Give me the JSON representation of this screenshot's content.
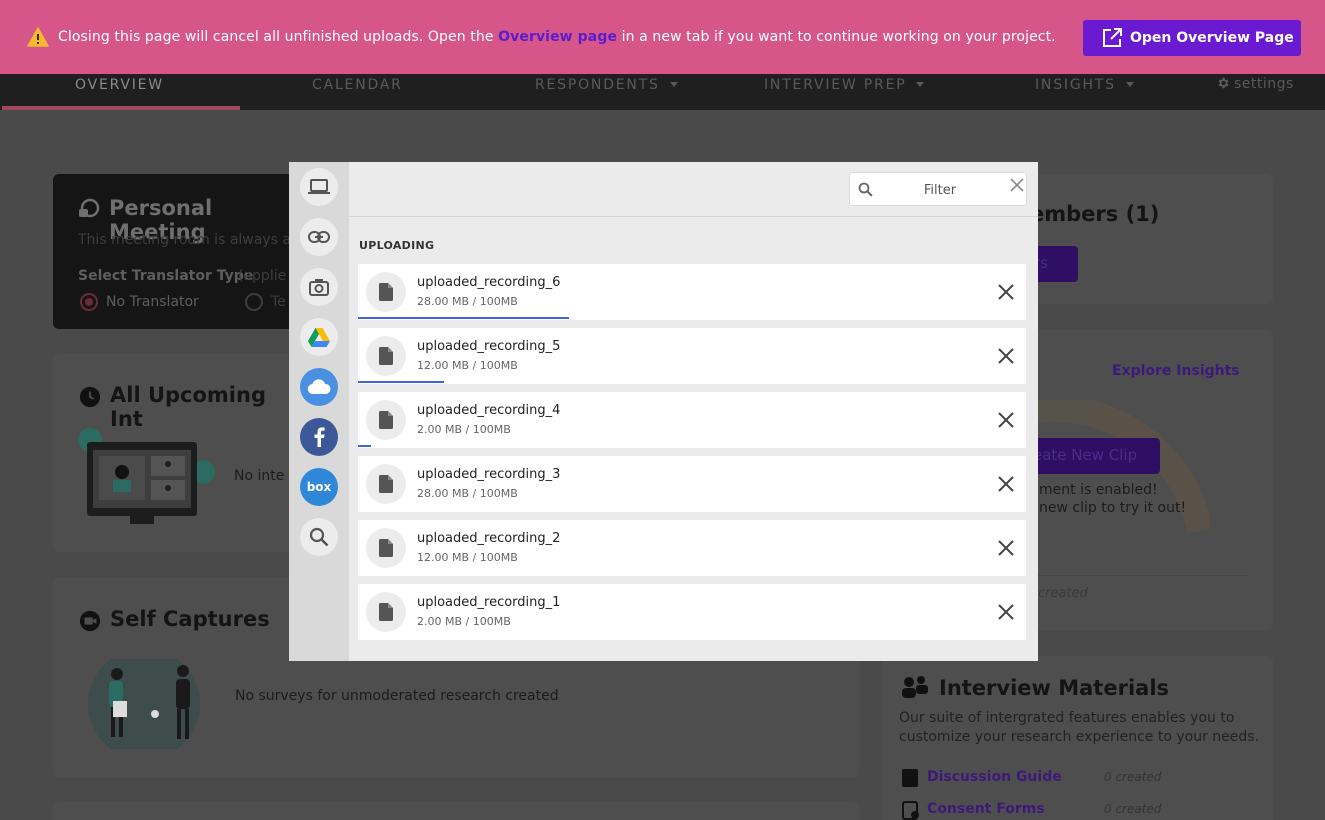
{
  "banner": {
    "text_before": "Closing this page will cancel all unfinished uploads. Open the",
    "link": "Overview page",
    "text_after": "in a new tab if you want to continue working on your project.",
    "button": "Open Overview Page"
  },
  "nav": {
    "overview": "OVERVIEW",
    "calendar": "CALENDAR",
    "respondents": "RESPONDENTS",
    "interview_prep": "INTERVIEW PREP",
    "insights": "INSIGHTS",
    "settings": "settings"
  },
  "bg": {
    "meeting_title": "Personal Meeting",
    "meeting_desc": "This meeting room is always a",
    "translator_label": "Select Translator Type",
    "translator_hint": "(applie",
    "no_translator": "No Translator",
    "other_option": "Te",
    "upcoming_title": "All Upcoming Int",
    "no_interviews": "No inte",
    "self_captures_title": "Self Captures",
    "no_surveys": "No surveys for unmoderated research created",
    "members_title": "embers (1)",
    "members_btn": "rs",
    "explore_insights": "Explore Insights",
    "create_clip": "eate New Clip",
    "clip_line1": "ment is enabled!",
    "clip_line2": "new clip to try it out!",
    "created_frag": "created",
    "materials_title": "Interview Materials",
    "materials_desc1": "Our suite of intergrated features enables you to",
    "materials_desc2": "customize your research experience to your needs.",
    "discussion_guide": "Discussion Guide",
    "consent_forms": "Consent Forms",
    "zero_created": "0 created"
  },
  "modal": {
    "filter_placeholder": "Filter",
    "section_label": "UPLOADING",
    "uploads": [
      {
        "name": "uploaded_recording_6",
        "size": "28.00 MB / 100MB",
        "progress": 0.316
      },
      {
        "name": "uploaded_recording_5",
        "size": "12.00 MB / 100MB",
        "progress": 0.128
      },
      {
        "name": "uploaded_recording_4",
        "size": "2.00 MB / 100MB",
        "progress": 0.02
      },
      {
        "name": "uploaded_recording_3",
        "size": "28.00 MB / 100MB",
        "progress": 0
      },
      {
        "name": "uploaded_recording_2",
        "size": "12.00 MB / 100MB",
        "progress": 0
      },
      {
        "name": "uploaded_recording_1",
        "size": "2.00 MB / 100MB",
        "progress": 0
      }
    ]
  },
  "colors": {
    "banner": "#d6568a",
    "banner_button": "#6a1ad1",
    "link": "#5b1ccf",
    "progress": "#3b64e6"
  },
  "icons": {
    "sources": [
      "laptop-icon",
      "link-icon",
      "camera-icon",
      "google-drive-icon",
      "onedrive-icon",
      "facebook-icon",
      "box-icon",
      "search-icon"
    ],
    "row": "file-icon",
    "remove": "close-icon"
  }
}
